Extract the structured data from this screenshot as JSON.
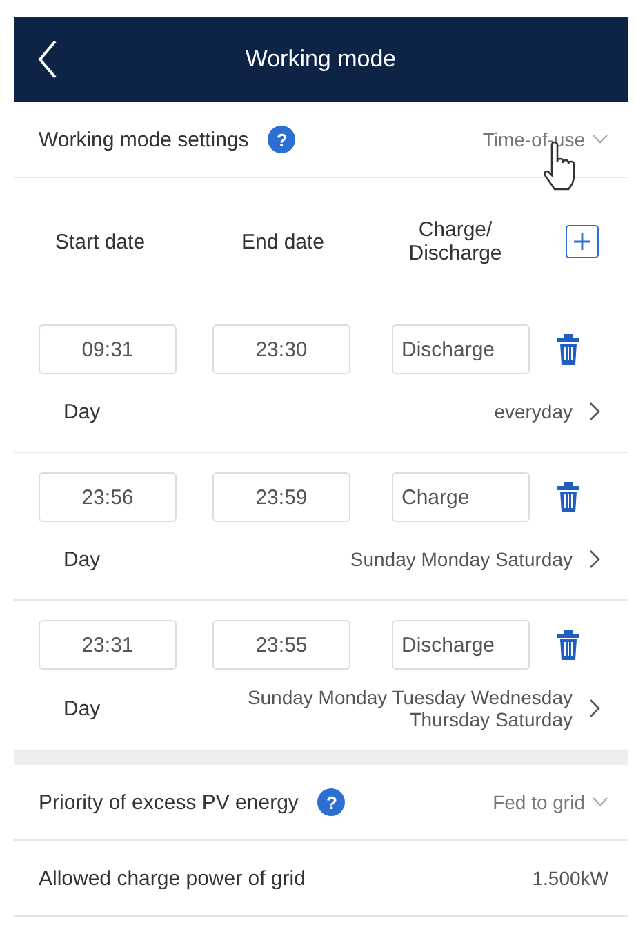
{
  "header": {
    "title": "Working mode"
  },
  "mode_setting": {
    "label": "Working mode settings",
    "help": "?",
    "value": "Time-of-use"
  },
  "columns": [
    "Start date",
    "End date",
    "Charge/\nDischarge"
  ],
  "schedules": [
    {
      "start": "09:31",
      "end": "23:30",
      "mode": "Discharge",
      "day_label": "Day",
      "days": "everyday"
    },
    {
      "start": "23:56",
      "end": "23:59",
      "mode": "Charge",
      "day_label": "Day",
      "days": "Sunday Monday Saturday"
    },
    {
      "start": "23:31",
      "end": "23:55",
      "mode": "Discharge",
      "day_label": "Day",
      "days": "Sunday Monday Tuesday Wednesday Thursday Saturday"
    }
  ],
  "priority": {
    "label": "Priority of excess PV energy",
    "help": "?",
    "value": "Fed to grid"
  },
  "charge_power": {
    "label": "Allowed charge power of grid",
    "value": "1.500kW"
  }
}
